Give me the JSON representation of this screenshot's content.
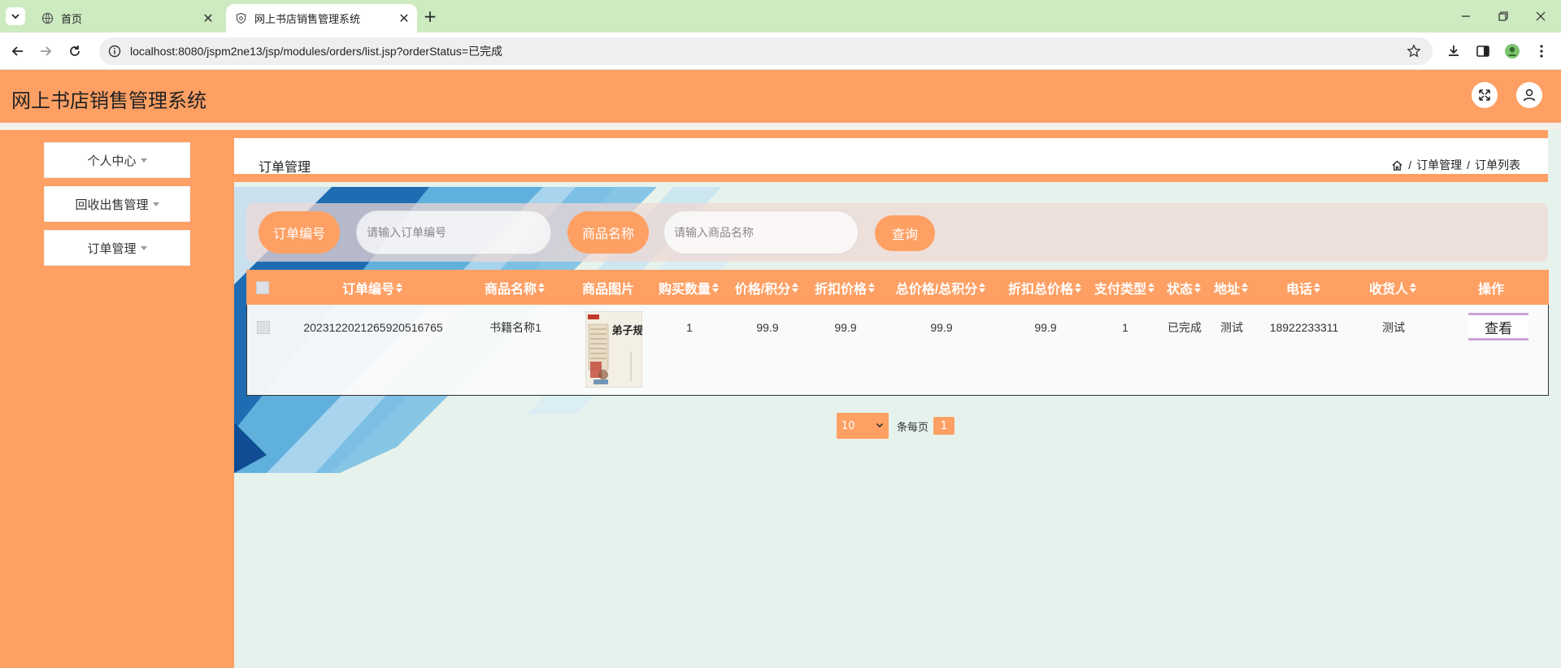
{
  "browser": {
    "tabs": [
      {
        "title": "首页"
      },
      {
        "title": "网上书店销售管理系统"
      }
    ],
    "url": "localhost:8080/jspm2ne13/jsp/modules/orders/list.jsp?orderStatus=已完成"
  },
  "app": {
    "title": "网上书店销售管理系统"
  },
  "sidebar": {
    "items": [
      {
        "label": "个人中心"
      },
      {
        "label": "回收出售管理"
      },
      {
        "label": "订单管理"
      }
    ]
  },
  "breadcrumb": {
    "page_title": "订单管理",
    "items": [
      "订单管理",
      "订单列表"
    ],
    "separator": "/"
  },
  "search": {
    "order_no_label": "订单编号",
    "order_no_placeholder": "请输入订单编号",
    "goods_name_label": "商品名称",
    "goods_name_placeholder": "请输入商品名称",
    "query_button": "查询"
  },
  "table": {
    "headers": [
      "订单编号",
      "商品名称",
      "商品图片",
      "购买数量",
      "价格/积分",
      "折扣价格",
      "总价格/总积分",
      "折扣总价格",
      "支付类型",
      "状态",
      "地址",
      "电话",
      "收货人",
      "操作"
    ],
    "rows": [
      {
        "order_no": "20231220212659205167 65",
        "goods_name": "书籍名称1",
        "image_alt": "弟子规",
        "quantity": "1",
        "price": "99.9",
        "discount_price": "99.9",
        "total_price": "99.9",
        "discount_total": "99.9",
        "pay_type": "1",
        "status": "已完成",
        "address": "测试",
        "phone": "18922233311",
        "receiver": "测试",
        "action": "查看"
      }
    ]
  },
  "pagination": {
    "page_size": "10",
    "page_size_suffix": "条每页",
    "current_page": "1"
  },
  "colors": {
    "accent": "#fea064",
    "background": "#e6f2ec",
    "browser_tabbar": "#cdeac0"
  }
}
